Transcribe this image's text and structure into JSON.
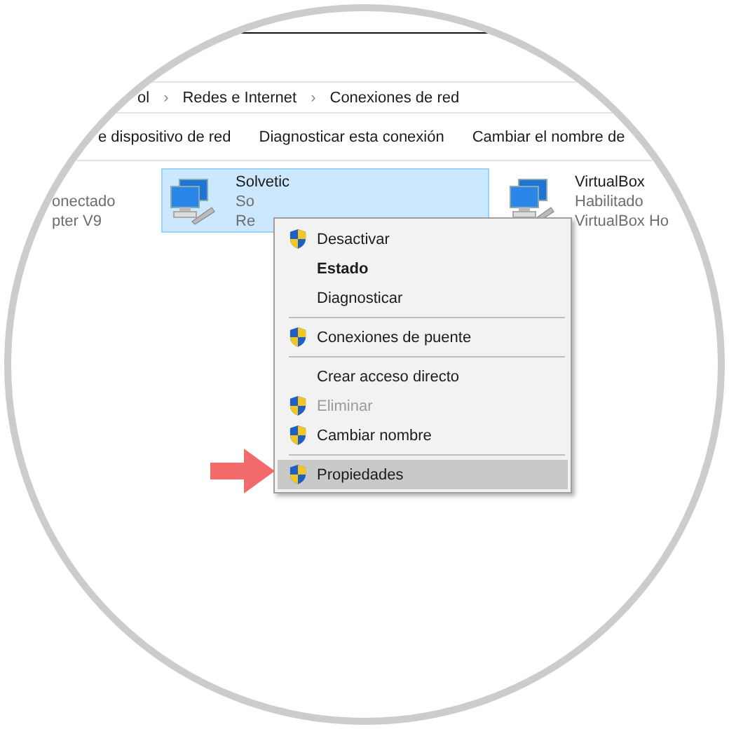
{
  "breadcrumb": [
    {
      "label": "ol",
      "separator": "›"
    },
    {
      "label": "Redes e Internet",
      "separator": "›"
    },
    {
      "label": "Conexiones de red"
    }
  ],
  "toolbar": [
    "e dispositivo de red",
    "Diagnosticar esta conexión",
    "Cambiar el nombre de"
  ],
  "connections": [
    {
      "status": "onectado",
      "device": "pter V9",
      "selected": false
    },
    {
      "name": "Solvetic",
      "status": "So",
      "device": "Re",
      "selected": true
    },
    {
      "name": "VirtualBox",
      "status": "Habilitado",
      "device": "VirtualBox Ho",
      "selected": false
    }
  ],
  "context_menu": [
    {
      "label": "Desactivar",
      "shield": true,
      "bold": false,
      "disabled": false,
      "selected": false
    },
    {
      "label": "Estado",
      "shield": false,
      "bold": true,
      "disabled": false,
      "selected": false
    },
    {
      "label": "Diagnosticar",
      "shield": false,
      "bold": false,
      "disabled": false,
      "selected": false,
      "separator_after": true
    },
    {
      "label": "Conexiones de puente",
      "shield": true,
      "bold": false,
      "disabled": false,
      "selected": false,
      "separator_after": true
    },
    {
      "label": "Crear acceso directo",
      "shield": false,
      "bold": false,
      "disabled": false,
      "selected": false
    },
    {
      "label": "Eliminar",
      "shield": true,
      "bold": false,
      "disabled": true,
      "selected": false
    },
    {
      "label": "Cambiar nombre",
      "shield": true,
      "bold": false,
      "disabled": false,
      "selected": false,
      "separator_after": true
    },
    {
      "label": "Propiedades",
      "shield": true,
      "bold": false,
      "disabled": false,
      "selected": true
    }
  ]
}
